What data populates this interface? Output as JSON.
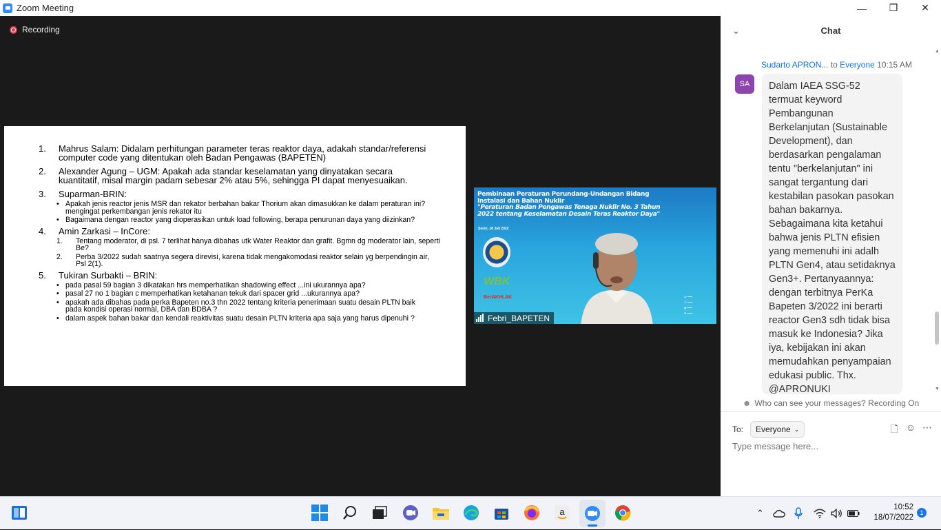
{
  "window": {
    "title": "Zoom Meeting"
  },
  "recording": {
    "label": "Recording"
  },
  "slide": {
    "items": [
      {
        "num": "1.",
        "text": "Mahrus Salam: Didalam perhitungan parameter teras reaktor daya, adakah standar/referensi computer code yang ditentukan oleh Badan Pengawas (BAPETEN)",
        "subs": []
      },
      {
        "num": "2.",
        "text": "Alexander Agung – UGM: Apakah ada standar keselamatan yang dinyatakan secara kuantitatif, misal margin padam sebesar 2% atau 5%, sehingga PI dapat menyesuaikan.",
        "subs": []
      },
      {
        "num": "3.",
        "text": "Suparman-BRIN:",
        "subs": [
          {
            "b": "•",
            "t": "Apakah jenis reactor jenis MSR dan rekator berbahan bakar Thorium akan dimasukkan ke dalam peraturan ini? mengingat perkembangan jenis rekator itu"
          },
          {
            "b": "•",
            "t": "Bagaimana dengan reactor yang dioperasikan untuk load following, berapa penurunan daya yang diizinkan?"
          }
        ]
      },
      {
        "num": "4.",
        "text": "Amin Zarkasi – InCore:",
        "numbered": true,
        "subs": [
          {
            "b": "1.",
            "t": "Tentang moderator, di psl. 7 terlihat hanya dibahas utk Water Reaktor dan grafit. Bgmn dg moderator lain, seperti Be?"
          },
          {
            "b": "2.",
            "t": "Perba 3/2022 sudah saatnya segera direvisi, karena tidak mengakomodasi reaktor selain yg berpendingin air, Psl 2(1)."
          }
        ]
      },
      {
        "num": "5.",
        "text": "Tukiran Surbakti – BRIN:",
        "subs": [
          {
            "b": "•",
            "t": "pada pasal 59 bagian 3 dikatakan hrs memperhatikan shadowing effect ...ini ukurannya apa?"
          },
          {
            "b": "•",
            "t": "pasal 27 no 1 bagian c memperhatikan ketahanan tekuk dari spacer grid ...ukurannya apa?"
          },
          {
            "b": "•",
            "t": "apakah ada dibahas pada perka Bapeten no.3  thn 2022 tentang kriteria penerimaan suatu desain PLTN  baik pada kondisi operasi normal, DBA dan BDBA ?"
          },
          {
            "b": "•",
            "t": "dalam aspek bahan bakar dan kendali reaktivitas suatu desain PLTN kriteria apa saja yang harus dipenuhi ?"
          }
        ]
      }
    ]
  },
  "video": {
    "banner_line1": "Pembinaan Peraturan Perundang-Undangan Bidang Instalasi dan Bahan Nuklir",
    "banner_line2": "\"Peraturan Badan Pengawas Tenaga Nuklir No. 3 Tahun 2022 tentang Keselamatan Desain Teras Reaktor Daya\"",
    "date": "Senin, 18 Juli 2022",
    "wbk": "WBK",
    "akhlak": "BerAKHLAK",
    "participant": "Febri_BAPETEN"
  },
  "chat": {
    "title": "Chat",
    "sender": "Sudarto APRON...",
    "to_word": "to",
    "recipient": "Everyone",
    "time": "10:15 AM",
    "avatar": "SA",
    "message": "Dalam IAEA SSG-52 termuat keyword Pembangunan Berkelanjutan (Sustainable Development), dan berdasarkan pengalaman tentu \"berkelanjutan\" ini sangat  tergantung dari kestabilan pasokan pasokan bahan bakarnya. Sebagaimana kita ketahui bahwa jenis PLTN efisien yang memenuhi ini adalh PLTN Gen4, atau setidaknya Gen3+. Pertanyaannya: dengan terbitnya PerKa Bapeten 3/2022 ini berarti reactor Gen3 sdh tidak bisa masuk ke Indonesia? Jika iya, kebijakan ini akan memudahkan penyampaian edukasi public. Thx. @APRONUKI",
    "visibility": "Who can see your messages? Recording On",
    "to_label": "To:",
    "to_value": "Everyone",
    "input_placeholder": "Type message here..."
  },
  "taskbar": {
    "time": "10:52",
    "date": "18/07/2022",
    "notifications": "1",
    "apps": [
      "widgets-icon",
      "start-icon",
      "search-icon",
      "task-view-icon",
      "teams-icon",
      "file-explorer-icon",
      "edge-icon",
      "store-icon",
      "firefox-icon",
      "amazon-icon",
      "zoom-icon",
      "chrome-icon"
    ]
  }
}
